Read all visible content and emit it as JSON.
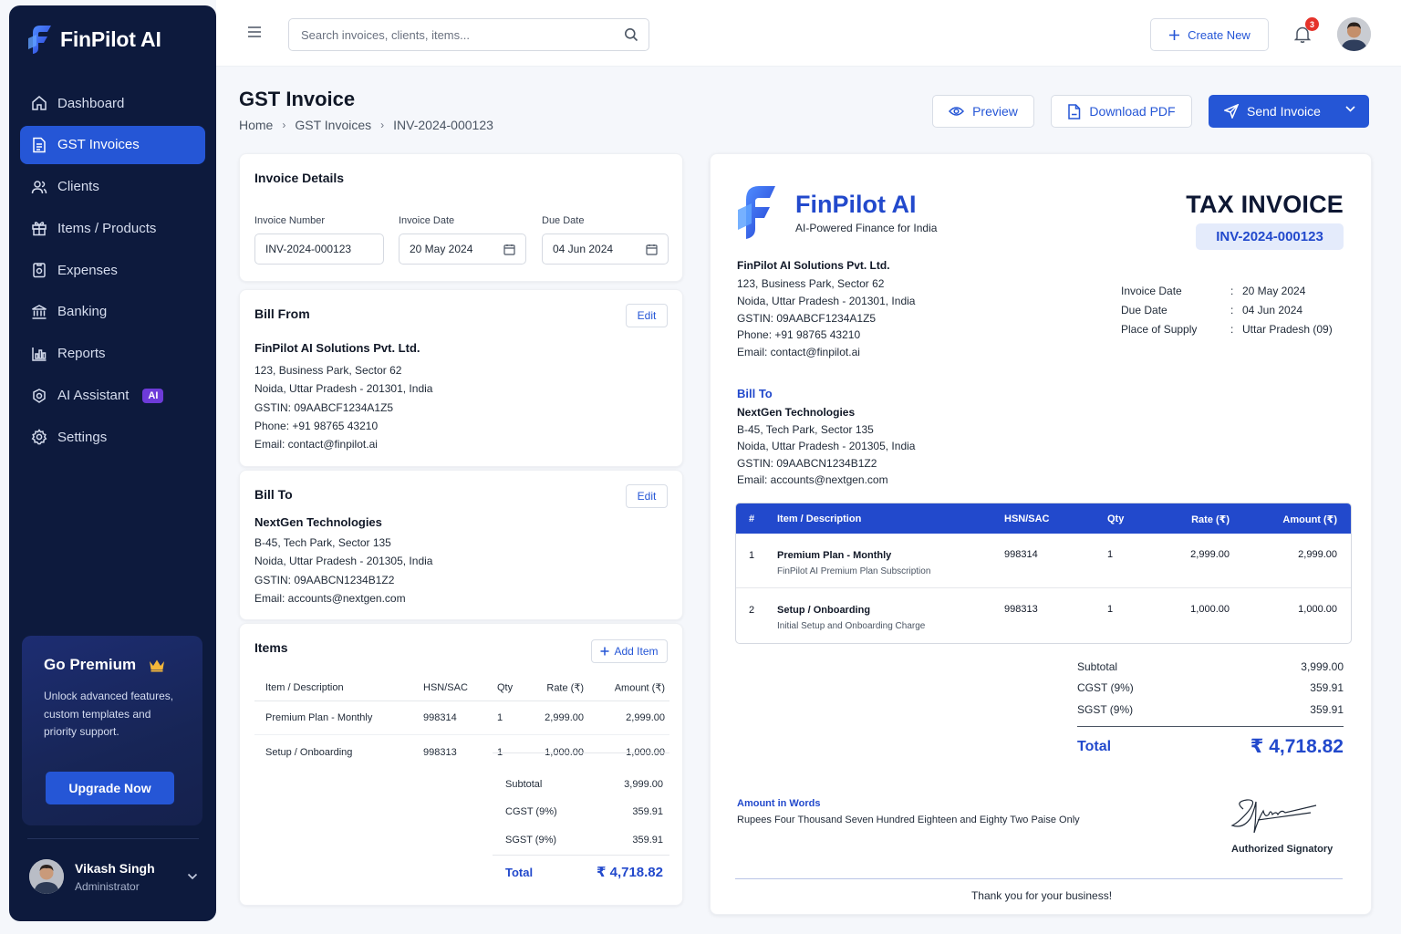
{
  "app": {
    "name": "FinPilot AI"
  },
  "sidebar": {
    "items": [
      {
        "label": "Dashboard",
        "icon": "home-icon"
      },
      {
        "label": "GST Invoices",
        "icon": "invoice-icon",
        "active": true
      },
      {
        "label": "Clients",
        "icon": "users-icon"
      },
      {
        "label": "Items / Products",
        "icon": "gift-box-icon"
      },
      {
        "label": "Expenses",
        "icon": "receipt-icon"
      },
      {
        "label": "Banking",
        "icon": "bank-icon"
      },
      {
        "label": "Reports",
        "icon": "bar-chart-icon"
      },
      {
        "label": "AI Assistant",
        "icon": "ai-brain-icon",
        "badge": "AI"
      },
      {
        "label": "Settings",
        "icon": "gear-icon"
      }
    ],
    "premium": {
      "title": "Go Premium",
      "text": "Unlock advanced features, custom templates and priority support.",
      "button": "Upgrade Now"
    },
    "user": {
      "name": "Vikash Singh",
      "role": "Administrator"
    }
  },
  "topbar": {
    "search_placeholder": "Search invoices, clients, items...",
    "create_label": "Create New",
    "notification_count": "3"
  },
  "page": {
    "title": "GST Invoice",
    "breadcrumb": [
      "Home",
      "GST Invoices",
      "INV-2024-000123"
    ],
    "actions": {
      "preview": "Preview",
      "download": "Download PDF",
      "send": "Send Invoice"
    }
  },
  "details": {
    "title": "Invoice Details",
    "number_label": "Invoice Number",
    "number": "INV-2024-000123",
    "date_label": "Invoice Date",
    "date": "20 May 2024",
    "due_label": "Due Date",
    "due": "04 Jun 2024"
  },
  "bill_from": {
    "title": "Bill From",
    "edit": "Edit",
    "name": "FinPilot AI Solutions Pvt. Ltd.",
    "lines": [
      "123, Business Park, Sector 62",
      "Noida, Uttar Pradesh - 201301, India",
      "GSTIN: 09AABCF1234A1Z5",
      "Phone: +91 98765 43210",
      "Email: contact@finpilot.ai"
    ]
  },
  "bill_to": {
    "title": "Bill To",
    "edit": "Edit",
    "name": "NextGen Technologies",
    "lines": [
      "B-45, Tech Park, Sector 135",
      "Noida, Uttar Pradesh - 201305, India",
      "GSTIN: 09AABCN1234B1Z2",
      "Email: accounts@nextgen.com"
    ]
  },
  "items": {
    "title": "Items",
    "add": "Add Item",
    "headers": [
      "Item / Description",
      "HSN/SAC",
      "Qty",
      "Rate (₹)",
      "Amount (₹)"
    ],
    "rows": [
      {
        "name": "Premium Plan - Monthly",
        "hsn": "998314",
        "qty": "1",
        "rate": "2,999.00",
        "amount": "2,999.00"
      },
      {
        "name": "Setup / Onboarding",
        "hsn": "998313",
        "qty": "1",
        "rate": "1,000.00",
        "amount": "1,000.00"
      }
    ],
    "subtotal_label": "Subtotal",
    "subtotal": "3,999.00",
    "cgst_label": "CGST (9%)",
    "cgst": "359.91",
    "sgst_label": "SGST (9%)",
    "sgst": "359.91",
    "total_label": "Total",
    "total": "₹ 4,718.82"
  },
  "invoice_preview": {
    "brand": "FinPilot AI",
    "tagline": "AI-Powered Finance for India",
    "doc_title": "TAX INVOICE",
    "number": "INV-2024-000123",
    "from_name": "FinPilot AI Solutions Pvt. Ltd.",
    "from_lines": [
      "123, Business Park, Sector 62",
      "Noida, Uttar Pradesh - 201301, India",
      "GSTIN: 09AABCF1234A1Z5",
      "Phone: +91 98765 43210",
      "Email: contact@finpilot.ai"
    ],
    "meta": [
      {
        "k": "Invoice Date",
        "v": "20 May 2024"
      },
      {
        "k": "Due Date",
        "v": "04 Jun 2024"
      },
      {
        "k": "Place of Supply",
        "v": "Uttar Pradesh (09)"
      }
    ],
    "bill_to_label": "Bill To",
    "bill_to_name": "NextGen Technologies",
    "bill_to_lines": [
      "B-45, Tech Park, Sector 135",
      "Noida, Uttar Pradesh - 201305, India",
      "GSTIN: 09AABCN1234B1Z2",
      "Email: accounts@nextgen.com"
    ],
    "headers": [
      "#",
      "Item / Description",
      "HSN/SAC",
      "Qty",
      "Rate (₹)",
      "Amount (₹)"
    ],
    "rows": [
      {
        "n": "1",
        "name": "Premium Plan - Monthly",
        "desc": "FinPilot AI Premium Plan Subscription",
        "hsn": "998314",
        "qty": "1",
        "rate": "2,999.00",
        "amount": "2,999.00"
      },
      {
        "n": "2",
        "name": "Setup / Onboarding",
        "desc": "Initial Setup and Onboarding Charge",
        "hsn": "998313",
        "qty": "1",
        "rate": "1,000.00",
        "amount": "1,000.00"
      }
    ],
    "subtotal_label": "Subtotal",
    "subtotal": "3,999.00",
    "cgst_label": "CGST (9%)",
    "cgst": "359.91",
    "sgst_label": "SGST (9%)",
    "sgst": "359.91",
    "total_label": "Total",
    "total": "₹ 4,718.82",
    "words_label": "Amount in Words",
    "words": "Rupees Four Thousand Seven Hundred Eighteen and Eighty Two Paise Only",
    "signatory": "Authorized Signatory",
    "thanks": "Thank you for your business!"
  },
  "colors": {
    "primary": "#2556d6",
    "sidebar": "#0d1a3d",
    "accent_purple": "#6d3bd9",
    "badge_red": "#e5332a"
  }
}
